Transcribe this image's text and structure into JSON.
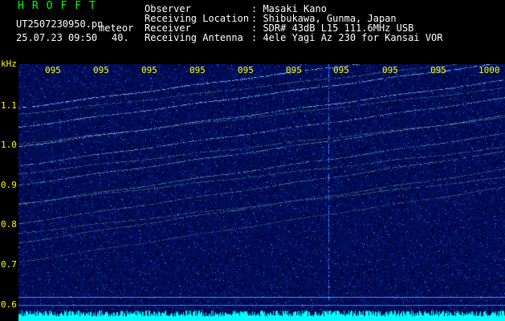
{
  "header": {
    "app_name": "HROFFT",
    "file_name": "UT2507230950.pn",
    "mode": "meteor",
    "datetime": "25.07.23 09:50",
    "count": "40."
  },
  "metadata": [
    {
      "label": "Observer",
      "value": ": Masaki Kano"
    },
    {
      "label": "Receiving Location",
      "value": ": Shibukawa, Gunma, Japan"
    },
    {
      "label": "Receiver",
      "value": ": SDR# 43dB L15 111.6MHz USB"
    },
    {
      "label": "Receiving Antenna",
      "value": ": 4ele Yagi Az 230 for Kansai VOR"
    }
  ],
  "spectrogram": {
    "unit": "kHz",
    "y_ticks": [
      {
        "label": "1.1",
        "value": 1.1
      },
      {
        "label": "1.0",
        "value": 1.0
      },
      {
        "label": "0.9",
        "value": 0.9
      },
      {
        "label": "0.8",
        "value": 0.8
      },
      {
        "label": "0.7",
        "value": 0.7
      },
      {
        "label": "0.6",
        "value": 0.6
      }
    ],
    "y_range_khz": [
      0.6,
      1.2
    ],
    "time_labels": [
      "095",
      "095",
      "095",
      "095",
      "095",
      "095",
      "095",
      "095",
      "095",
      "1000"
    ],
    "colors": {
      "label_text": "#ffffff",
      "app_title": "#00ff00",
      "axis_labels": "#ffff00",
      "trace": "#8cc8ff",
      "background_noise": "#0000b4",
      "signal_band": "#00ffff",
      "header_background": "#000000"
    }
  }
}
